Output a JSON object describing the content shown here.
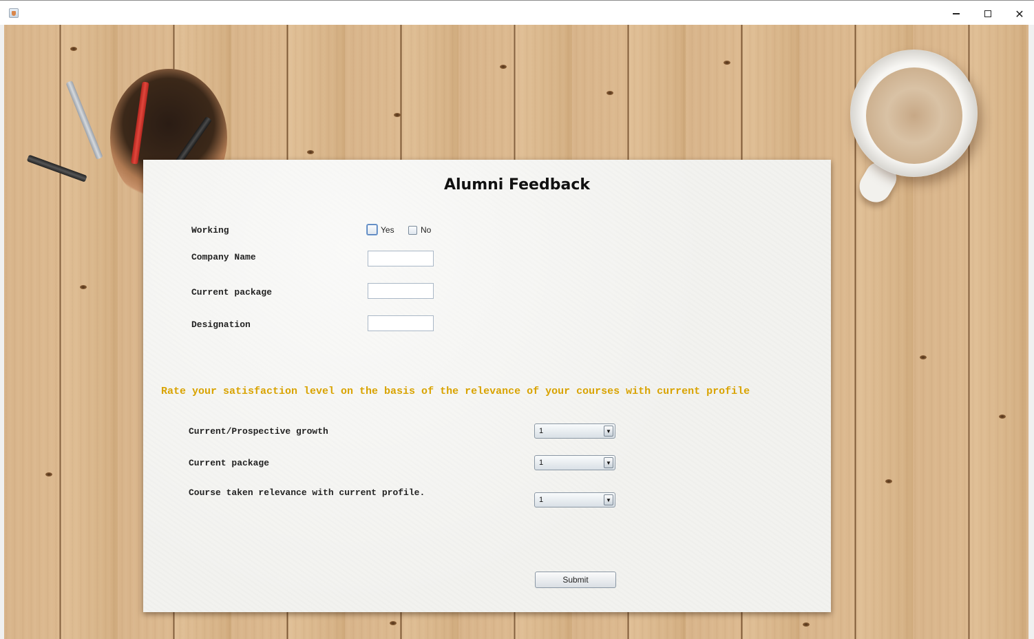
{
  "window": {
    "icons": {
      "app": "java-cup-icon",
      "minimize": "minimize-icon",
      "maximize": "maximize-icon",
      "close": "close-icon"
    },
    "minimize_glyph": "–",
    "close_glyph": "✕"
  },
  "form": {
    "title": "Alumni Feedback",
    "working_label": "Working",
    "working_options": [
      "Yes",
      "No"
    ],
    "company_label": "Company Name",
    "company_value": "",
    "package_label": "Current package",
    "package_value": "",
    "designation_label": "Designation",
    "designation_value": "",
    "rating_prompt": "Rate your satisfaction level on the basis of the relevance of your courses with current profile",
    "ratings": [
      {
        "label": "Current/Prospective growth",
        "value": "1"
      },
      {
        "label": "Current package",
        "value": "1"
      },
      {
        "label": "Course taken relevance with current profile.",
        "value": "1"
      }
    ],
    "dropdown_arrow": "▼",
    "submit_label": "Submit"
  },
  "colors": {
    "prompt": "#d9a300",
    "paper": "#f2f2ef",
    "desk": "#d8b48a"
  }
}
